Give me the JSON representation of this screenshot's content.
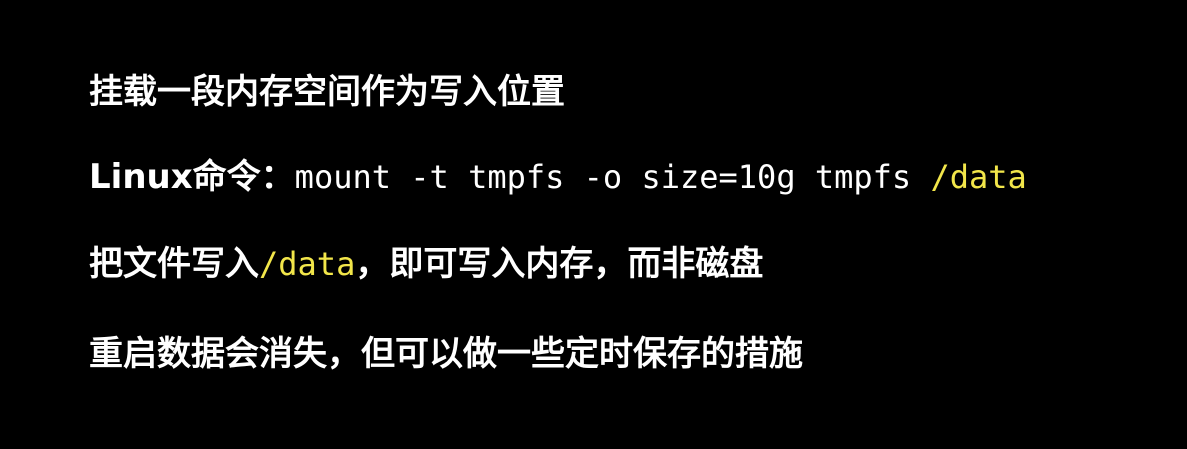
{
  "slide": {
    "line1": "挂载一段内存空间作为写入位置",
    "line2": {
      "prefix": "Linux命令：",
      "command": "mount -t tmpfs -o size=10g tmpfs ",
      "path": "/data"
    },
    "line3": {
      "before": "把文件写入",
      "path": "/data",
      "after": "，即可写入内存，而非磁盘"
    },
    "line4": "重启数据会消失，但可以做一些定时保存的措施"
  },
  "colors": {
    "background": "#000000",
    "text": "#ffffff",
    "highlight": "#f2e64a"
  }
}
